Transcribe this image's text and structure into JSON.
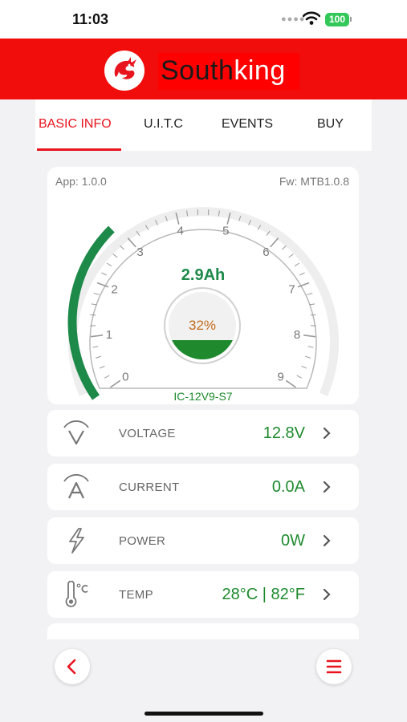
{
  "status_bar": {
    "time": "11:03",
    "battery": "100",
    "wifi_icon": "wifi-icon",
    "signal_icon": "signal-dots-icon"
  },
  "brand": {
    "name_dark": "South",
    "name_light": "king",
    "logo_icon": "dragon-logo-icon",
    "bar_color": "#f20d0d"
  },
  "tabs": [
    {
      "label": "BASIC INFO",
      "active": true
    },
    {
      "label": "U.I.T.C",
      "active": false
    },
    {
      "label": "EVENTS",
      "active": false
    },
    {
      "label": "BUY",
      "active": false
    }
  ],
  "gauge": {
    "app_version": "App: 1.0.0",
    "fw_version": "Fw: MTB1.0.8",
    "capacity": "2.9Ah",
    "capacity_value": 2.9,
    "scale_min": 0,
    "scale_max": 9,
    "tick_labels": [
      "0",
      "1",
      "2",
      "3",
      "4",
      "5",
      "6",
      "7",
      "8",
      "9"
    ],
    "soc_text": "32%",
    "soc_fraction": 0.32,
    "model": "IC-12V9-S7",
    "arc_color": "#1e8a4a"
  },
  "metrics": [
    {
      "label": "VOLTAGE",
      "value": "12.8V",
      "icon": "voltage-icon"
    },
    {
      "label": "CURRENT",
      "value": "0.0A",
      "icon": "current-icon"
    },
    {
      "label": "POWER",
      "value": "0W",
      "icon": "power-icon"
    },
    {
      "label": "TEMP",
      "value": "28°C | 82°F",
      "icon": "thermometer-icon"
    }
  ],
  "nav": {
    "back_icon": "back-chevron-icon",
    "menu_icon": "menu-icon",
    "accent": "#e8141e"
  }
}
